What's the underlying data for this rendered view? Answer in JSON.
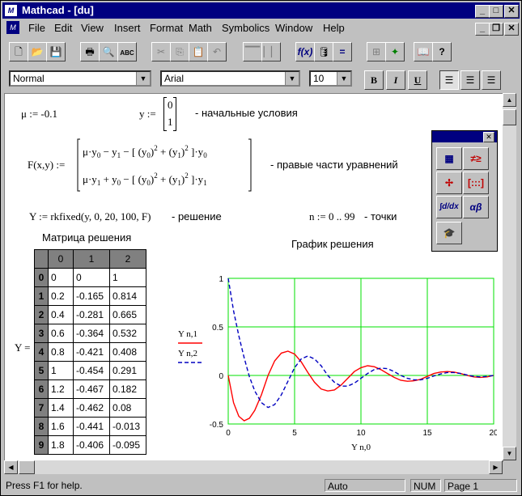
{
  "window": {
    "title": "Mathcad - [du]",
    "app_icon": "mathcad-app-icon",
    "controls": {
      "minimize": "_",
      "maximize": "□",
      "close": "✕"
    }
  },
  "menu": {
    "icon": "mathcad-doc-icon",
    "items": [
      "File",
      "Edit",
      "View",
      "Insert",
      "Format",
      "Math",
      "Symbolics",
      "Window",
      "Help"
    ],
    "doc_controls": {
      "minimize": "_",
      "restore": "❐",
      "close": "✕"
    }
  },
  "toolbar": {
    "buttons": [
      "new-icon",
      "open-icon",
      "save-icon",
      "print-icon",
      "print-preview-icon",
      "spellcheck-icon",
      "cut-icon",
      "copy-icon",
      "paste-icon",
      "undo-icon",
      "align-horizontal-icon",
      "align-vertical-icon",
      "insert-function-icon",
      "insert-unit-icon",
      "calculate-icon",
      "insert-component-icon",
      "resource-center-icon",
      "electronic-book-icon",
      "help-icon"
    ]
  },
  "format_bar": {
    "style": "Normal",
    "font": "Arial",
    "size": "10",
    "bold": "B",
    "italic": "I",
    "underline": "U"
  },
  "worksheet": {
    "mu_def": "μ := -0.1",
    "y_def": "y :=",
    "y_vec": [
      "0",
      "1"
    ],
    "init_note": "- начальные условия",
    "F_lhs": "F(x,y) :=",
    "rhs_note": "- правые части уравнений",
    "Y_def": "Y := rkfixed(y, 0, 20, 100, F)",
    "solution_note": "- решение",
    "n_def": "n := 0 .. 99",
    "points_note": "- точки",
    "matrix_title": "Матрица решения",
    "matrix_lhs": "Y =",
    "graph_title": "График решения",
    "matrix": {
      "headers": [
        "0",
        "1",
        "2"
      ],
      "rows": [
        [
          "0",
          "0",
          "0",
          "1"
        ],
        [
          "1",
          "0.2",
          "-0.165",
          "0.814"
        ],
        [
          "2",
          "0.4",
          "-0.281",
          "0.665"
        ],
        [
          "3",
          "0.6",
          "-0.364",
          "0.532"
        ],
        [
          "4",
          "0.8",
          "-0.421",
          "0.408"
        ],
        [
          "5",
          "1",
          "-0.454",
          "0.291"
        ],
        [
          "6",
          "1.2",
          "-0.467",
          "0.182"
        ],
        [
          "7",
          "1.4",
          "-0.462",
          "0.08"
        ],
        [
          "8",
          "1.6",
          "-0.441",
          "-0.013"
        ],
        [
          "9",
          "1.8",
          "-0.406",
          "-0.095"
        ]
      ]
    }
  },
  "chart_data": {
    "type": "line",
    "title": "График решения",
    "xlabel": "Y n,0",
    "ylabel": [
      "Y n,1",
      "Y n,2"
    ],
    "xlim": [
      0,
      20
    ],
    "ylim": [
      -0.5,
      1
    ],
    "x_ticks": [
      "0",
      "5",
      "10",
      "15",
      "20"
    ],
    "y_ticks": [
      "-0.5",
      "0",
      "0.5",
      "1"
    ],
    "grid": true,
    "series": [
      {
        "name": "Y n,1",
        "color": "#ff0000",
        "style": "solid",
        "x": [
          0,
          0.4,
          0.8,
          1.2,
          1.6,
          2,
          2.5,
          3,
          3.5,
          4,
          4.5,
          5,
          5.5,
          6,
          6.5,
          7,
          7.5,
          8,
          8.5,
          9,
          9.5,
          10,
          10.5,
          11,
          11.5,
          12,
          12.5,
          13,
          13.5,
          14,
          14.5,
          15,
          15.5,
          16,
          16.5,
          17,
          17.5,
          18,
          18.5,
          19,
          19.5,
          20
        ],
        "y": [
          0,
          -0.281,
          -0.421,
          -0.467,
          -0.441,
          -0.36,
          -0.2,
          0,
          0.15,
          0.23,
          0.25,
          0.22,
          0.14,
          0.03,
          -0.07,
          -0.14,
          -0.16,
          -0.15,
          -0.1,
          -0.03,
          0.04,
          0.08,
          0.1,
          0.09,
          0.06,
          0.02,
          -0.02,
          -0.05,
          -0.06,
          -0.055,
          -0.04,
          -0.01,
          0.02,
          0.035,
          0.04,
          0.035,
          0.02,
          0.0,
          -0.015,
          -0.02,
          -0.015,
          0.0
        ]
      },
      {
        "name": "Y n,2",
        "color": "#0000c0",
        "style": "dashed",
        "x": [
          0,
          0.4,
          0.8,
          1.2,
          1.6,
          2,
          2.5,
          3,
          3.5,
          4,
          4.5,
          5,
          5.5,
          6,
          6.5,
          7,
          7.5,
          8,
          8.5,
          9,
          9.5,
          10,
          10.5,
          11,
          11.5,
          12,
          12.5,
          13,
          13.5,
          14,
          14.5,
          15,
          15.5,
          16,
          16.5,
          17,
          17.5,
          18,
          18.5,
          19,
          19.5,
          20
        ],
        "y": [
          1,
          0.665,
          0.408,
          0.182,
          -0.013,
          -0.16,
          -0.28,
          -0.33,
          -0.3,
          -0.2,
          -0.06,
          0.08,
          0.17,
          0.2,
          0.17,
          0.1,
          0.0,
          -0.07,
          -0.11,
          -0.11,
          -0.08,
          -0.03,
          0.02,
          0.06,
          0.075,
          0.07,
          0.04,
          0.0,
          -0.03,
          -0.045,
          -0.045,
          -0.03,
          -0.005,
          0.015,
          0.03,
          0.03,
          0.02,
          0.005,
          -0.01,
          -0.015,
          -0.01,
          0.0
        ]
      }
    ]
  },
  "palette": {
    "buttons": [
      "calculator-icon",
      "boolean-icon",
      "graph-icon",
      "matrix-icon",
      "calculus-icon",
      "greek-icon",
      "programming-icon"
    ]
  },
  "status": {
    "help": "Press F1 for help.",
    "mode": "Auto",
    "num": "NUM",
    "page": "Page 1"
  }
}
